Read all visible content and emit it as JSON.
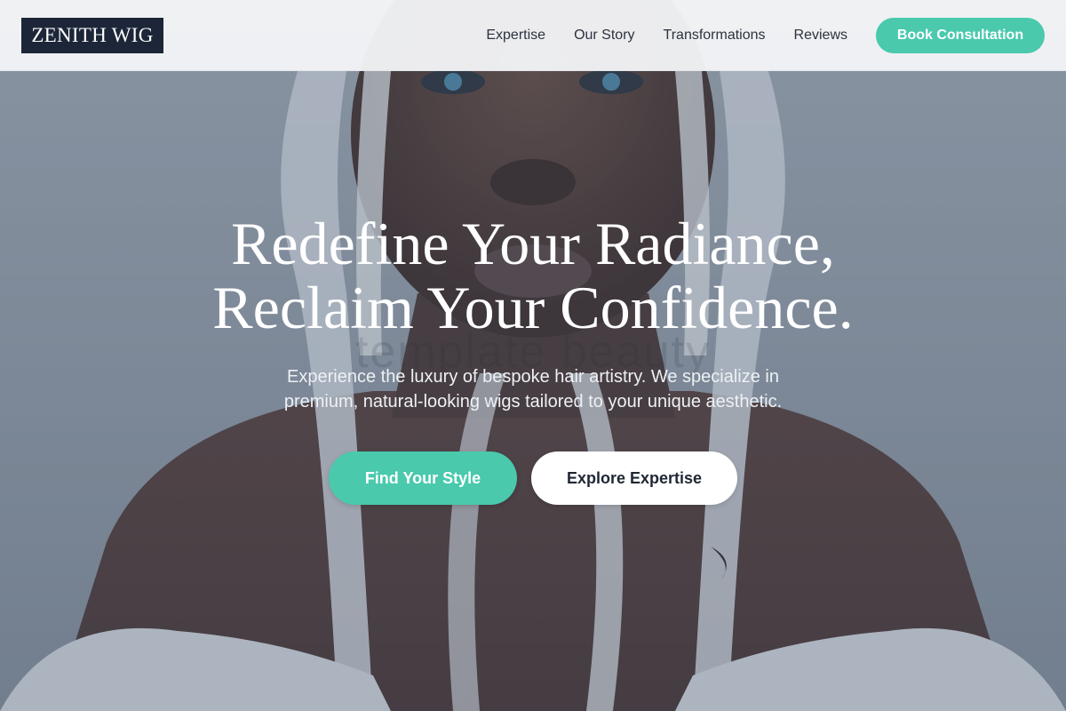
{
  "brand": {
    "logo_text": "ZENITH WIG"
  },
  "nav": {
    "links": [
      "Expertise",
      "Our Story",
      "Transformations",
      "Reviews"
    ],
    "cta_label": "Book Consultation"
  },
  "hero": {
    "headline_line1": "Redefine Your Radiance,",
    "headline_line2": "Reclaim Your Confidence.",
    "watermark": "template beauty",
    "subtext": "Experience the luxury of bespoke hair artistry. We specialize in premium, natural-looking wigs tailored to your unique aesthetic.",
    "primary_cta": "Find Your Style",
    "secondary_cta": "Explore Expertise",
    "image_description_icon": "portrait-photo"
  },
  "colors": {
    "accent": "#4ac9ad",
    "logo_bg": "#1c2638",
    "nav_bg": "#f4f6f8",
    "text_dark": "#2b3340"
  }
}
